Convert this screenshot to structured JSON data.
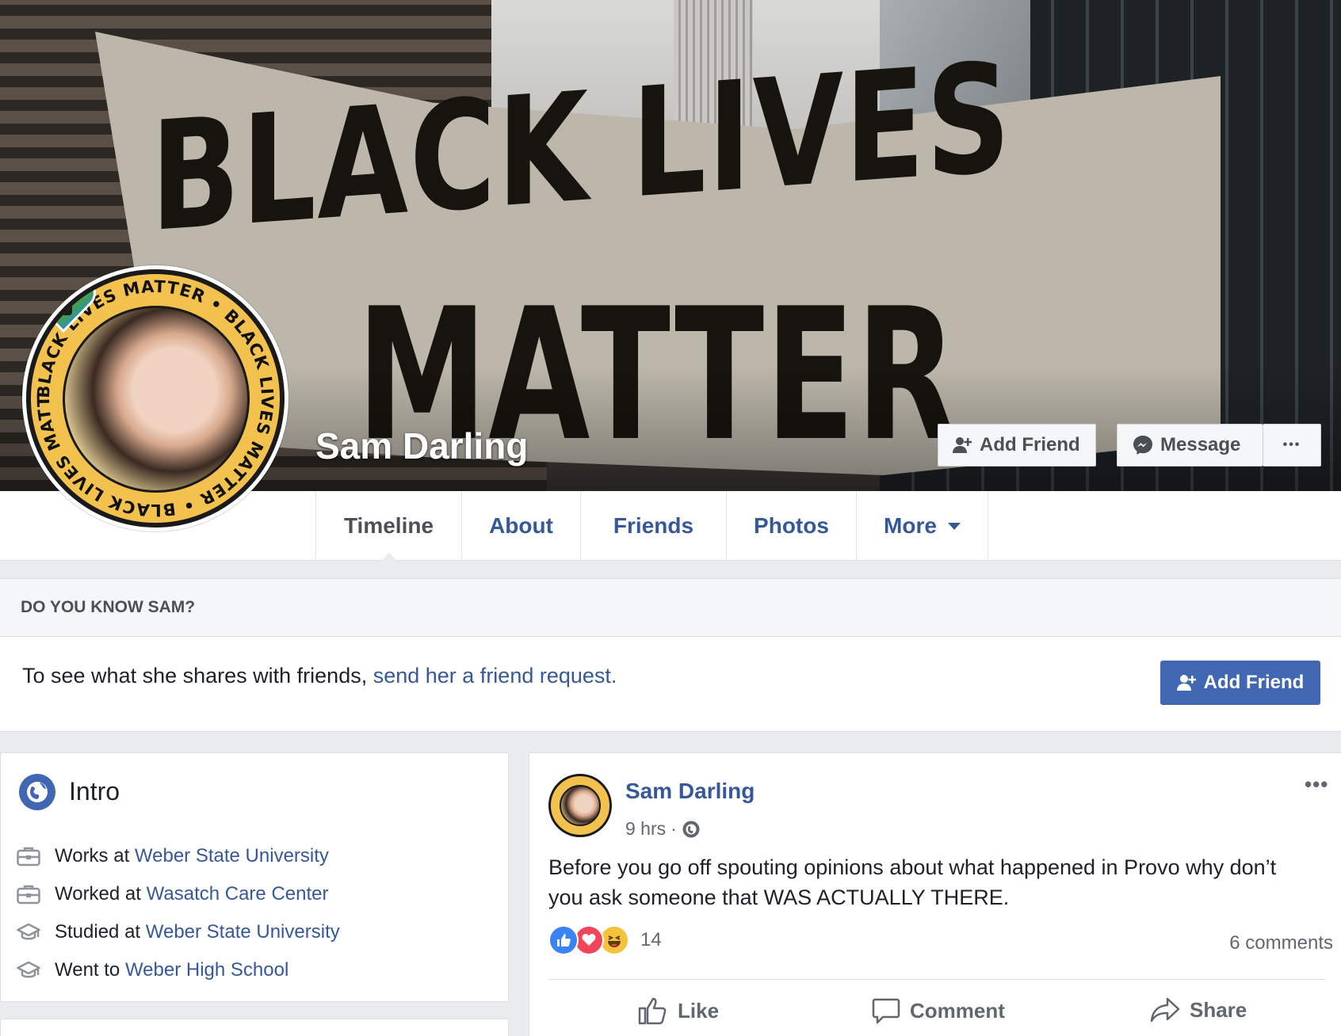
{
  "cover": {
    "banner_line1": "BLACK LIVES",
    "banner_line2": "MATTER"
  },
  "profile": {
    "name": "Sam Darling",
    "avatar_ring_text": "BLACK LIVES MATTER • BLACK LIVES MATTER • BLACK LIVES MATTER •",
    "add_friend_label": "Add Friend",
    "message_label": "Message",
    "more_label": "•••"
  },
  "nav": {
    "tabs": [
      {
        "label": "Timeline"
      },
      {
        "label": "About"
      },
      {
        "label": "Friends"
      },
      {
        "label": "Photos"
      },
      {
        "label": "More"
      }
    ]
  },
  "know": {
    "header": "DO YOU KNOW SAM?",
    "text": "To see what she shares with friends, ",
    "link": "send her a friend request.",
    "button_label": "Add Friend"
  },
  "intro": {
    "title": "Intro",
    "rows": [
      {
        "icon": "briefcase-icon",
        "prefix": "Works at ",
        "link": "Weber State University"
      },
      {
        "icon": "briefcase-icon",
        "prefix": "Worked at ",
        "link": "Wasatch Care Center"
      },
      {
        "icon": "graduation-cap-icon",
        "prefix": "Studied at ",
        "link": "Weber State University"
      },
      {
        "icon": "graduation-cap-icon",
        "prefix": "Went to ",
        "link": "Weber High School"
      }
    ]
  },
  "post": {
    "author": "Sam Darling",
    "time": "9 hrs",
    "separator": "·",
    "options": "•••",
    "text": "Before you go off spouting opinions about what happened in Provo why don’t you ask someone that WAS ACTUALLY THERE.",
    "reaction_count": "14",
    "comment_count": "6 comments",
    "actions": {
      "like": "Like",
      "comment": "Comment",
      "share": "Share"
    }
  },
  "colors": {
    "brand_blue": "#4267b2",
    "link_blue": "#365899",
    "page_bg": "#e9ebee",
    "avatar_ring": "#f2c14e"
  }
}
